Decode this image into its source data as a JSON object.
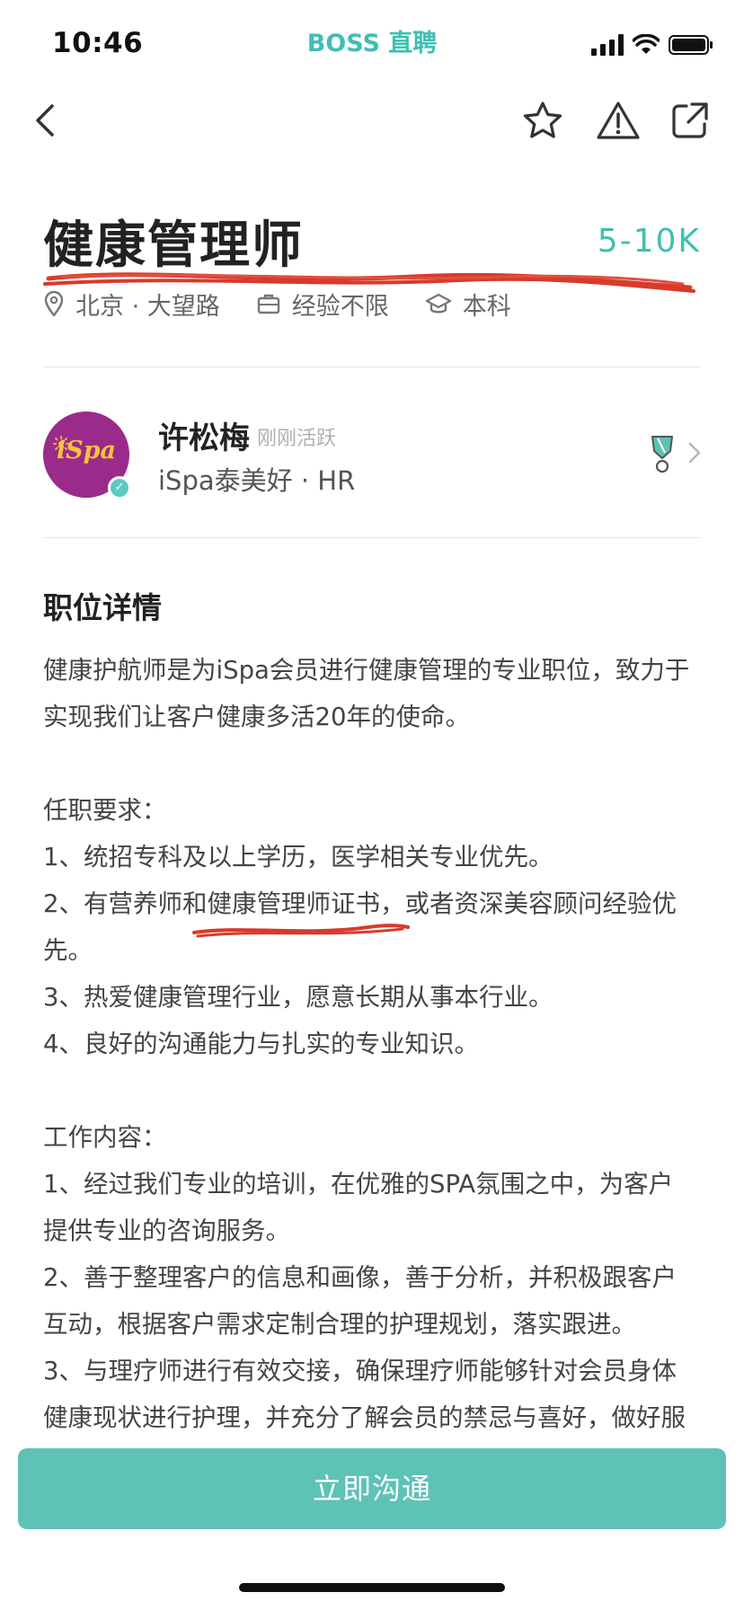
{
  "status_bar": {
    "time": "10:46",
    "brand": "BOSS 直聘"
  },
  "nav": {
    "back_icon": "chevron-left-icon",
    "favorite_icon": "star-icon",
    "report_icon": "warning-icon",
    "share_icon": "share-icon"
  },
  "job": {
    "title": "健康管理师",
    "salary": "5-10K",
    "location": "北京 · 大望路",
    "experience": "经验不限",
    "education": "本科"
  },
  "recruiter": {
    "avatar_text": "iSpa",
    "name": "许松梅",
    "status": "刚刚活跃",
    "company": "iSpa泰美好 · HR"
  },
  "details": {
    "section_title": "职位详情",
    "lines": [
      "健康护航师是为iSpa会员进行健康管理的专业职位，致力于",
      "实现我们让客户健康多活20年的使命。",
      "",
      "任职要求：",
      "1、统招专科及以上学历，医学相关专业优先。",
      "2、有营养师和健康管理师证书，或者资深美容顾问经验优",
      "先。",
      "3、热爱健康管理行业，愿意长期从事本行业。",
      "4、良好的沟通能力与扎实的专业知识。",
      "",
      "工作内容：",
      "1、经过我们专业的培训，在优雅的SPA氛围之中，为客户",
      "提供专业的咨询服务。",
      "2、善于整理客户的信息和画像，善于分析，并积极跟客户",
      "互动，根据客户需求定制合理的护理规划，落实跟进。",
      "3、与理疗师进行有效交接，确保理疗师能够针对会员身体",
      "健康现状进行护理，并充分了解会员的禁忌与喜好，做好服"
    ]
  },
  "actions": {
    "chat_label": "立即沟通"
  },
  "colors": {
    "accent": "#3fbfb3",
    "button": "#5ec2b6",
    "annotation": "#d93a2b",
    "avatar_bg": "#9a2b8a"
  }
}
